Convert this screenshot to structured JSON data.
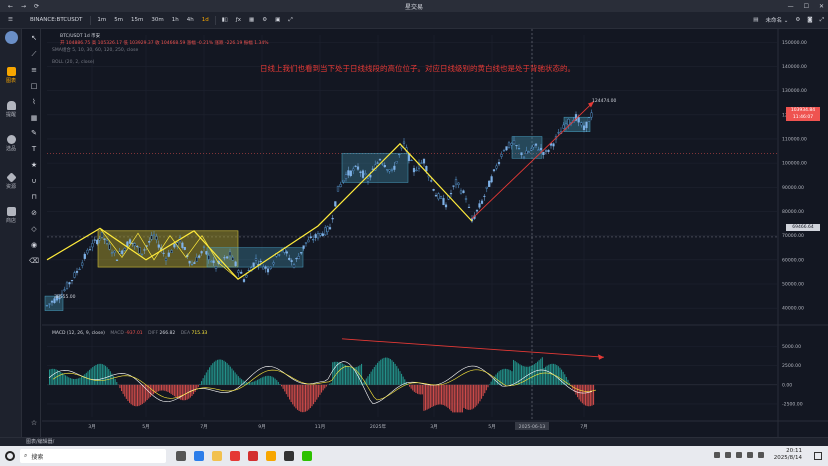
{
  "window": {
    "title": "星交易",
    "nav": [
      "←",
      "→",
      "⟳"
    ],
    "controls": [
      "—",
      "☐",
      "✕"
    ]
  },
  "toolbar": {
    "symbol": "BINANCE:BTCUSDT",
    "timeframes": [
      "1m",
      "5m",
      "15m",
      "30m",
      "1h",
      "4h",
      "1d"
    ],
    "right_label": "未命名 ⌄"
  },
  "sidebar": {
    "items": [
      {
        "icon": "chart-icon",
        "label": "图表",
        "color": "#f7a600"
      },
      {
        "icon": "bell-icon",
        "label": "提醒",
        "color": "#b2b5be"
      },
      {
        "icon": "stock-select-icon",
        "label": "选品",
        "color": "#b2b5be"
      },
      {
        "icon": "diamond-icon",
        "label": "资源",
        "color": "#b2b5be"
      },
      {
        "icon": "store-icon",
        "label": "商店",
        "color": "#b2b5be"
      }
    ]
  },
  "legend": {
    "symbol_line": "BTC/USDT  1d  币安",
    "ohlc": "开 104886.75  高 105326.17  低 103929.37  收 104668.59  涨幅 -0.21%  涨跌 -226.19  振幅 1.34%",
    "sma": "SMA组合 5, 10, 30, 60, 120, 250, close",
    "boll": "BOLL (20, 2, close)",
    "macd_name": "MACD (12, 26, 9, close)",
    "macd_label": "MACD",
    "macd_value": "-937.01",
    "dif_label": "DIFF",
    "dif_value": "266.82",
    "dea_label": "DEA",
    "dea_value": "715.33"
  },
  "annotation": {
    "text": "日线上我们也看到当下处于日线线段的高位位子。对应日线级别的黄白线也是处于背驰状态的。",
    "color": "#e53935"
  },
  "chart_data": {
    "type": "candlestick",
    "price_axis": {
      "ticks": [
        "150000.00",
        "140000.00",
        "130000.00",
        "120000.00",
        "110000.00",
        "100000.00",
        "90000.00",
        "80000.00",
        "70000.00",
        "60000.00",
        "50000.00",
        "40000.00"
      ],
      "ylim": [
        38000,
        153000
      ]
    },
    "macd_axis": {
      "ticks": [
        "5000.00",
        "2500.00",
        "0.00",
        "-2500.00"
      ],
      "ylim": [
        -4200,
        6500
      ]
    },
    "time_axis": {
      "ticks": [
        "3月",
        "5月",
        "7月",
        "9月",
        "11月",
        "2025年",
        "3月",
        "5月",
        "2025-06-13",
        "7月"
      ]
    },
    "price_labels": {
      "current": "103934.84",
      "countdown": "11:46:07",
      "crosshair": "69466.64",
      "high": "124474.00",
      "low": "38555.00"
    },
    "colors": {
      "up": "#26a69a",
      "down": "#ef5350",
      "segment": "#ffeb3b",
      "center_box_yellow": "#b8a92d",
      "center_box_blue": "#4aa3c4",
      "arrow": "#e53935"
    }
  },
  "statusbar": {
    "text": "图表/编辑器/"
  },
  "taskbar": {
    "search_placeholder": "搜索",
    "time": "20:11",
    "date": "2025/8/14"
  }
}
